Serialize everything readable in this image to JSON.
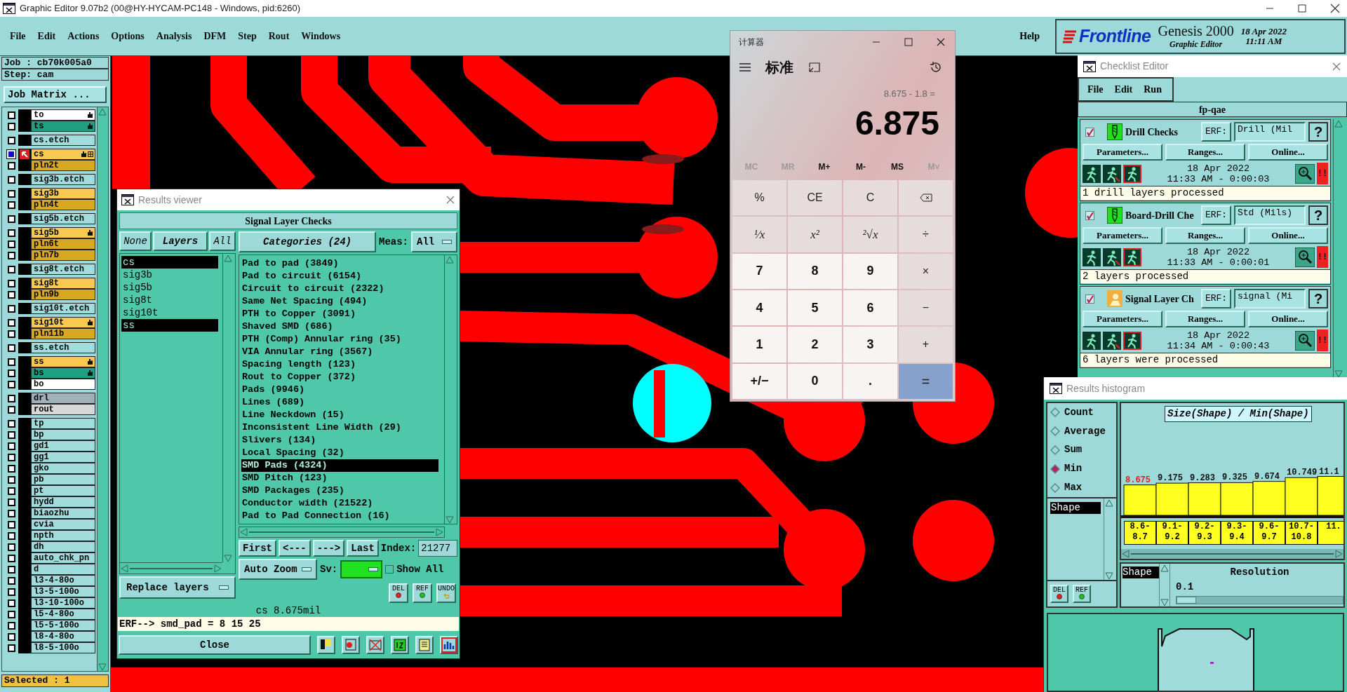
{
  "window": {
    "title": "Graphic Editor 9.07b2 (00@HY-HYCAM-PC148 - Windows, pid:6260)"
  },
  "menu": [
    "File",
    "Edit",
    "Actions",
    "Options",
    "Analysis",
    "DFM",
    "Step",
    "Rout",
    "Windows"
  ],
  "help_menu": "Help",
  "brand": {
    "logo": "Frontline",
    "product": "Genesis 2000",
    "subtitle": "Graphic Editor",
    "date": "18 Apr 2022",
    "time": "11:11 AM"
  },
  "job_panel": {
    "job": "Job : cb70k005a0",
    "step": "Step: cam",
    "matrix_button": "Job Matrix ...",
    "selected_count": "Selected : 1",
    "layer_groups": [
      {
        "layers": [
          {
            "name": "to",
            "color": "#ffffff",
            "hand": true,
            "selected": false
          },
          {
            "name": "ts",
            "color": "#20a080",
            "hand": true,
            "selected": false
          }
        ]
      },
      {
        "layers": [
          {
            "name": "cs.etch",
            "color": "#a0dcdc",
            "hand": false,
            "selected": false
          }
        ]
      },
      {
        "layers": [
          {
            "name": "cs",
            "color": "#f8c850",
            "hand": true,
            "selected": true
          },
          {
            "name": "pln2t",
            "color": "#d8a820",
            "hand": false,
            "selected": false
          }
        ]
      },
      {
        "layers": [
          {
            "name": "sig3b.etch",
            "color": "#a0dcdc",
            "hand": false,
            "selected": false
          }
        ]
      },
      {
        "layers": [
          {
            "name": "sig3b",
            "color": "#f8c850",
            "hand": false,
            "selected": false
          },
          {
            "name": "pln4t",
            "color": "#d8a820",
            "hand": false,
            "selected": false
          }
        ]
      },
      {
        "layers": [
          {
            "name": "sig5b.etch",
            "color": "#a0dcdc",
            "hand": false,
            "selected": false
          }
        ]
      },
      {
        "layers": [
          {
            "name": "sig5b",
            "color": "#f8c850",
            "hand": true,
            "selected": false
          },
          {
            "name": "pln6t",
            "color": "#d8a820",
            "hand": false,
            "selected": false
          },
          {
            "name": "pln7b",
            "color": "#d8a820",
            "hand": false,
            "selected": false
          }
        ]
      },
      {
        "layers": [
          {
            "name": "sig8t.etch",
            "color": "#a0dcdc",
            "hand": false,
            "selected": false
          }
        ]
      },
      {
        "layers": [
          {
            "name": "sig8t",
            "color": "#f8c850",
            "hand": false,
            "selected": false
          },
          {
            "name": "pln9b",
            "color": "#d8a820",
            "hand": false,
            "selected": false
          }
        ]
      },
      {
        "layers": [
          {
            "name": "sig10t.etch",
            "color": "#a0dcdc",
            "hand": false,
            "selected": false
          }
        ]
      },
      {
        "layers": [
          {
            "name": "sig10t",
            "color": "#f8c850",
            "hand": true,
            "selected": false
          },
          {
            "name": "pln11b",
            "color": "#d8a820",
            "hand": false,
            "selected": false
          }
        ]
      },
      {
        "layers": [
          {
            "name": "ss.etch",
            "color": "#a0dcdc",
            "hand": false,
            "selected": false
          }
        ]
      },
      {
        "layers": [
          {
            "name": "ss",
            "color": "#f8c850",
            "hand": true,
            "selected": false
          },
          {
            "name": "bs",
            "color": "#20a080",
            "hand": true,
            "selected": false
          },
          {
            "name": "bo",
            "color": "#ffffff",
            "hand": false,
            "selected": false
          }
        ]
      },
      {
        "layers": [
          {
            "name": "drl",
            "color": "#a0b0b8",
            "hand": false,
            "selected": false
          },
          {
            "name": "rout",
            "color": "#d8d8d8",
            "hand": false,
            "selected": false
          }
        ]
      },
      {
        "layers": [
          {
            "name": "tp",
            "color": "#a0dcdc",
            "hand": false,
            "selected": false
          },
          {
            "name": "bp",
            "color": "#a0dcdc",
            "hand": false,
            "selected": false
          },
          {
            "name": "gd1",
            "color": "#a0dcdc",
            "hand": false,
            "selected": false
          },
          {
            "name": "gg1",
            "color": "#a0dcdc",
            "hand": false,
            "selected": false
          },
          {
            "name": "gko",
            "color": "#a0dcdc",
            "hand": false,
            "selected": false
          },
          {
            "name": "pb",
            "color": "#a0dcdc",
            "hand": false,
            "selected": false
          },
          {
            "name": "pt",
            "color": "#a0dcdc",
            "hand": false,
            "selected": false
          },
          {
            "name": "hydd",
            "color": "#a0dcdc",
            "hand": false,
            "selected": false
          },
          {
            "name": "biaozhu",
            "color": "#a0dcdc",
            "hand": false,
            "selected": false
          },
          {
            "name": "cvia",
            "color": "#a0dcdc",
            "hand": false,
            "selected": false
          },
          {
            "name": "npth",
            "color": "#a0dcdc",
            "hand": false,
            "selected": false
          },
          {
            "name": "dh",
            "color": "#a0dcdc",
            "hand": false,
            "selected": false
          },
          {
            "name": "auto_chk_pn",
            "color": "#a0dcdc",
            "hand": false,
            "selected": false
          },
          {
            "name": "d",
            "color": "#a0dcdc",
            "hand": false,
            "selected": false
          },
          {
            "name": "l3-4-80o",
            "color": "#a0dcdc",
            "hand": false,
            "selected": false
          },
          {
            "name": "l3-5-100o",
            "color": "#a0dcdc",
            "hand": false,
            "selected": false
          },
          {
            "name": "l3-10-100o",
            "color": "#a0dcdc",
            "hand": false,
            "selected": false
          },
          {
            "name": "l5-4-80o",
            "color": "#a0dcdc",
            "hand": false,
            "selected": false
          },
          {
            "name": "l5-5-100o",
            "color": "#a0dcdc",
            "hand": false,
            "selected": false
          },
          {
            "name": "l8-4-80o",
            "color": "#a0dcdc",
            "hand": false,
            "selected": false
          },
          {
            "name": "l8-5-100o",
            "color": "#a0dcdc",
            "hand": false,
            "selected": false
          }
        ]
      }
    ]
  },
  "results_viewer": {
    "title": "Results viewer",
    "header": "Signal Layer Checks",
    "layer_buttons": [
      "None",
      "Layers",
      "All"
    ],
    "layers": [
      {
        "name": "cs",
        "selected": true
      },
      {
        "name": "sig3b",
        "selected": false
      },
      {
        "name": "sig5b",
        "selected": false
      },
      {
        "name": "sig8t",
        "selected": false
      },
      {
        "name": "sig10t",
        "selected": false
      },
      {
        "name": "ss",
        "selected": true
      }
    ],
    "categories_button": "Categories (24)",
    "meas_label": "Meas:",
    "meas_value": "All",
    "categories": [
      {
        "label": "Pad to pad (3849)",
        "selected": false
      },
      {
        "label": "Pad to circuit (6154)",
        "selected": false
      },
      {
        "label": "Circuit to circuit (2322)",
        "selected": false
      },
      {
        "label": "Same Net Spacing (494)",
        "selected": false
      },
      {
        "label": "PTH to Copper (3091)",
        "selected": false
      },
      {
        "label": "Shaved SMD (686)",
        "selected": false
      },
      {
        "label": "PTH (Comp) Annular ring (35)",
        "selected": false
      },
      {
        "label": "VIA Annular ring (3567)",
        "selected": false
      },
      {
        "label": "Spacing length (123)",
        "selected": false
      },
      {
        "label": "Rout to Copper (372)",
        "selected": false
      },
      {
        "label": "Pads (9946)",
        "selected": false
      },
      {
        "label": "Lines (689)",
        "selected": false
      },
      {
        "label": "Line Neckdown (15)",
        "selected": false
      },
      {
        "label": "Inconsistent Line Width (29)",
        "selected": false
      },
      {
        "label": "Slivers (134)",
        "selected": false
      },
      {
        "label": "Local Spacing (32)",
        "selected": false
      },
      {
        "label": "SMD Pads (4324)",
        "selected": true
      },
      {
        "label": "SMD Pitch (123)",
        "selected": false
      },
      {
        "label": "SMD Packages (235)",
        "selected": false
      },
      {
        "label": "Conductor width (21522)",
        "selected": false
      },
      {
        "label": "Pad to Pad Connection (16)",
        "selected": false
      }
    ],
    "nav_buttons": [
      "First",
      "<---",
      "--->",
      "Last"
    ],
    "index_label": "Index:",
    "index_value": "21277",
    "zoom_mode": "Auto Zoom",
    "sv": {
      "label": "Sv:",
      "color": "#20e020"
    },
    "show_all": {
      "label": "Show All",
      "checked": false
    },
    "replace_mode": "Replace layers",
    "action_buttons": [
      "DEL",
      "REF",
      "UNDO"
    ],
    "status": "cs 8.675mil",
    "erf_line": "ERF--> smd_pad = 8 15 25",
    "close_button": "Close"
  },
  "calculator": {
    "title": "计算器",
    "mode": "标准",
    "expression": "8.675 - 1.8 =",
    "display": "6.875",
    "memory": [
      {
        "label": "MC",
        "disabled": true
      },
      {
        "label": "MR",
        "disabled": true
      },
      {
        "label": "M+",
        "disabled": false
      },
      {
        "label": "M-",
        "disabled": false
      },
      {
        "label": "MS",
        "disabled": false
      },
      {
        "label": "M˅",
        "disabled": true
      }
    ],
    "keys": [
      {
        "label": "%",
        "kind": "op"
      },
      {
        "label": "CE",
        "kind": "op"
      },
      {
        "label": "C",
        "kind": "op"
      },
      {
        "kind": "backspace"
      },
      {
        "label": "¹⁄x",
        "kind": "func"
      },
      {
        "label": "x²",
        "kind": "func"
      },
      {
        "label": "²√x",
        "kind": "func"
      },
      {
        "label": "÷",
        "kind": "op"
      },
      {
        "label": "7",
        "kind": "digit"
      },
      {
        "label": "8",
        "kind": "digit"
      },
      {
        "label": "9",
        "kind": "digit"
      },
      {
        "label": "×",
        "kind": "op"
      },
      {
        "label": "4",
        "kind": "digit"
      },
      {
        "label": "5",
        "kind": "digit"
      },
      {
        "label": "6",
        "kind": "digit"
      },
      {
        "label": "−",
        "kind": "op"
      },
      {
        "label": "1",
        "kind": "digit"
      },
      {
        "label": "2",
        "kind": "digit"
      },
      {
        "label": "3",
        "kind": "digit"
      },
      {
        "label": "+",
        "kind": "op"
      },
      {
        "label": "+/−",
        "kind": "digit"
      },
      {
        "label": "0",
        "kind": "digit"
      },
      {
        "label": ".",
        "kind": "digit"
      },
      {
        "label": "=",
        "kind": "equals"
      }
    ]
  },
  "checklist_editor": {
    "title": "Checklist Editor",
    "menu": [
      "File",
      "Edit",
      "Run"
    ],
    "checklist_name": "fp-qae",
    "checks": [
      {
        "kind": "drill",
        "name": "Drill Checks",
        "enabled": true,
        "erf_label": "ERF:",
        "erf_value": "Drill (Mil",
        "help": "?",
        "buttons": [
          "Parameters...",
          "Ranges...",
          "Online..."
        ],
        "date": "18 Apr 2022",
        "time": "11:33 AM - 0:00:03",
        "alert": "!!",
        "status": "1 drill layers processed"
      },
      {
        "kind": "drill",
        "name": "Board-Drill Che",
        "enabled": true,
        "erf_label": "ERF:",
        "erf_value": "Std (Mils)",
        "help": "?",
        "buttons": [
          "Parameters...",
          "Ranges...",
          "Online..."
        ],
        "date": "18 Apr 2022",
        "time": "11:33 AM - 0:00:01",
        "alert": "!!",
        "status": "2 layers processed"
      },
      {
        "kind": "signal",
        "name": "Signal Layer Ch",
        "enabled": true,
        "erf_label": "ERF:",
        "erf_value": "signal (Mi",
        "help": "?",
        "buttons": [
          "Parameters...",
          "Ranges...",
          "Online..."
        ],
        "date": "18 Apr 2022",
        "time": "11:34 AM - 0:00:43",
        "alert": "!!",
        "status": "6 layers were processed"
      }
    ]
  },
  "results_histogram": {
    "title": "Results histogram",
    "modes": [
      {
        "label": "Count",
        "selected": false
      },
      {
        "label": "Average",
        "selected": false
      },
      {
        "label": "Sum",
        "selected": false
      },
      {
        "label": "Min",
        "selected": true
      },
      {
        "label": "Max",
        "selected": false
      }
    ],
    "fields": [
      {
        "label": "Shape",
        "selected": true
      }
    ],
    "buttons": [
      "DEL",
      "REF"
    ],
    "chart_data": {
      "type": "bar",
      "title": "Size(Shape) / Min(Shape)",
      "categories": [
        "8.6-\n8.7",
        "9.1-\n9.2",
        "9.2-\n9.3",
        "9.3-\n9.4",
        "9.6-\n9.7",
        "10.7-\n10.8",
        "11."
      ],
      "values": [
        8.675,
        9.175,
        9.283,
        9.325,
        9.674,
        10.749,
        11.1
      ],
      "data_labels": true
    },
    "resolution": {
      "fields": [
        {
          "label": "Shape",
          "selected": true
        }
      ],
      "label": "Resolution",
      "value": "0.1",
      "level": 0
    }
  }
}
